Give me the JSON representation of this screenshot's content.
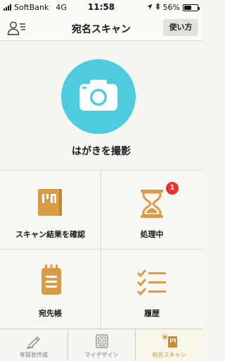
{
  "status_bar": {
    "carrier": "SoftBank",
    "network": "4G",
    "time": "11:58",
    "battery": "56%",
    "battery_level": 0.56
  },
  "nav": {
    "title": "宛名スキャン",
    "help_label": "使い方"
  },
  "hero": {
    "label": "はがきを撮影"
  },
  "grid": {
    "scan_results": "スキャン結果を確認",
    "processing": "処理中",
    "processing_badge": "1",
    "address_book": "宛先帳",
    "history": "履歴"
  },
  "tabs": [
    {
      "label": "年賀状作成",
      "icon": "pencil-icon"
    },
    {
      "label": "マイデザイン",
      "icon": "design-icon"
    },
    {
      "label": "宛名スキャン",
      "icon": "scan-icon"
    }
  ],
  "colors": {
    "accent": "#c98a36",
    "camera": "#4ecbde",
    "badge": "#e8322d"
  }
}
